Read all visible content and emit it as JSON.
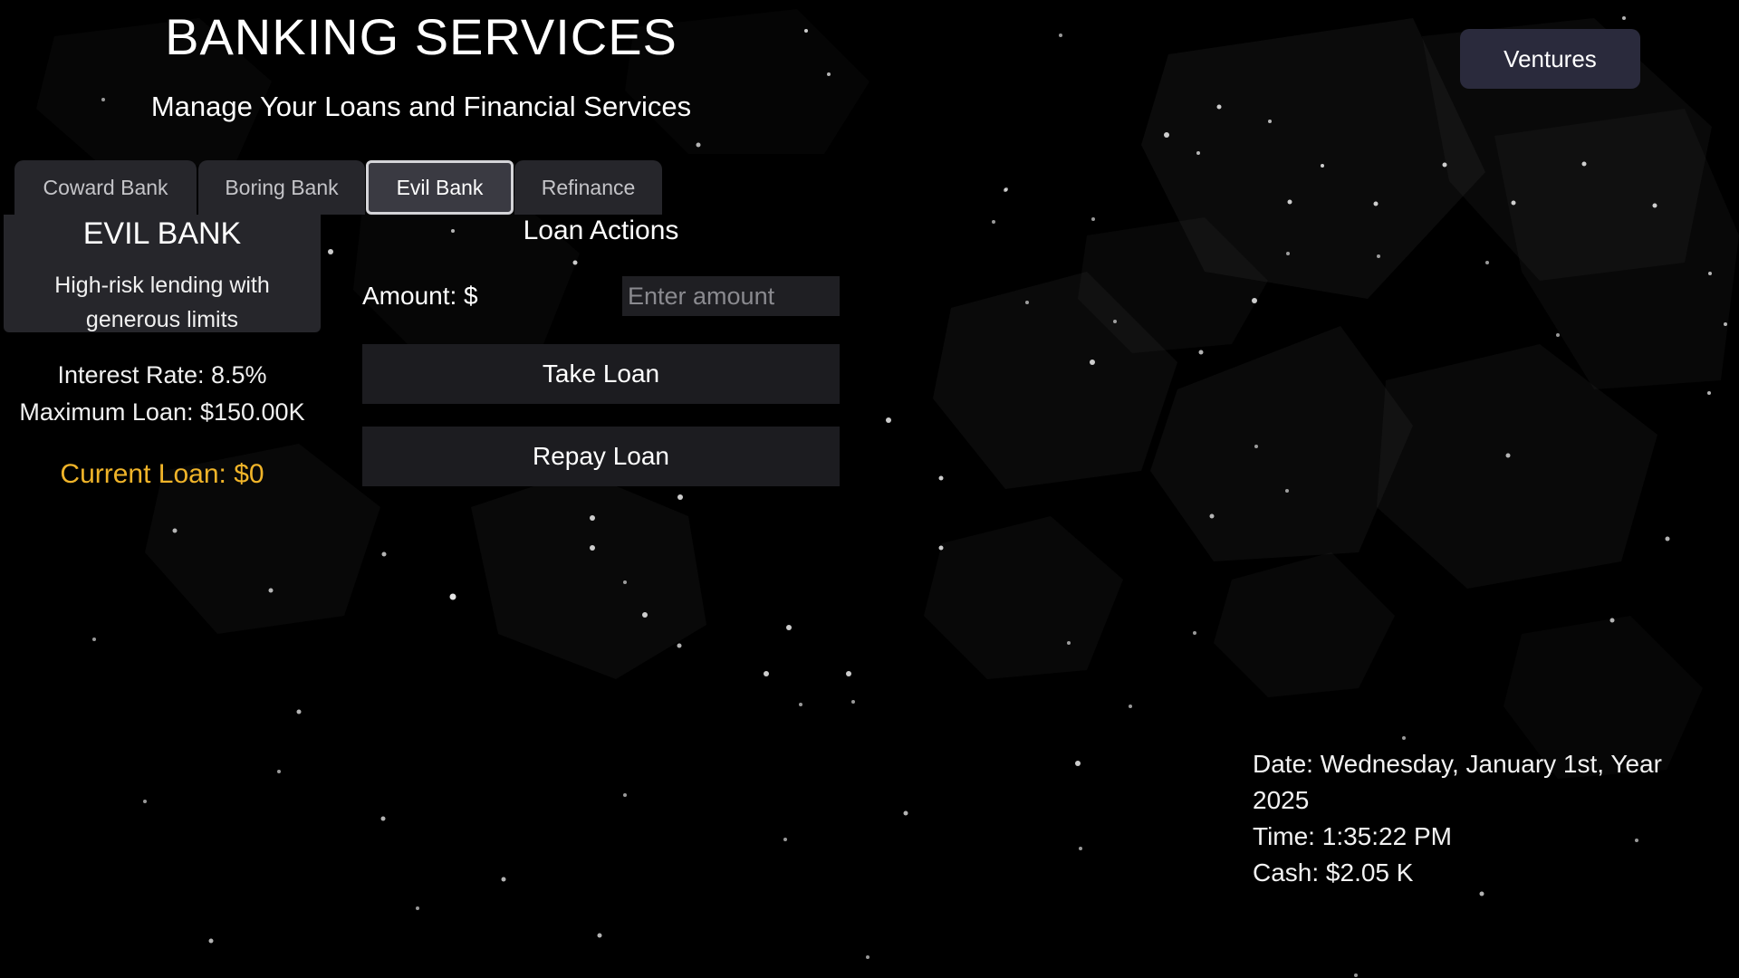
{
  "header": {
    "title": "BANKING SERVICES",
    "subtitle": "Manage Your Loans and Financial Services"
  },
  "nav": {
    "ventures_label": "Ventures"
  },
  "tabs": [
    {
      "label": "Coward Bank",
      "active": false
    },
    {
      "label": "Boring Bank",
      "active": false
    },
    {
      "label": "Evil Bank",
      "active": true
    },
    {
      "label": "Refinance",
      "active": false
    }
  ],
  "bank": {
    "name": "EVIL BANK",
    "description_line1": "High-risk lending with",
    "description_line2": "generous limits",
    "interest_rate": "Interest Rate: 8.5%",
    "max_loan": "Maximum Loan: $150.00K",
    "current_loan": "Current Loan: $0"
  },
  "loan_actions": {
    "title": "Loan Actions",
    "amount_label": "Amount: $",
    "amount_value": "",
    "amount_placeholder": "Enter amount",
    "take_label": "Take Loan",
    "repay_label": "Repay Loan"
  },
  "status": {
    "date_line1": "Date: Wednesday, January 1st, Year",
    "date_line2": "2025",
    "time": "Time: 1:35:22 PM",
    "cash": "Cash: $2.05 K"
  },
  "colors": {
    "background": "#000000",
    "accent_gold": "#f0b429",
    "button_dark": "#2a2a3c"
  }
}
